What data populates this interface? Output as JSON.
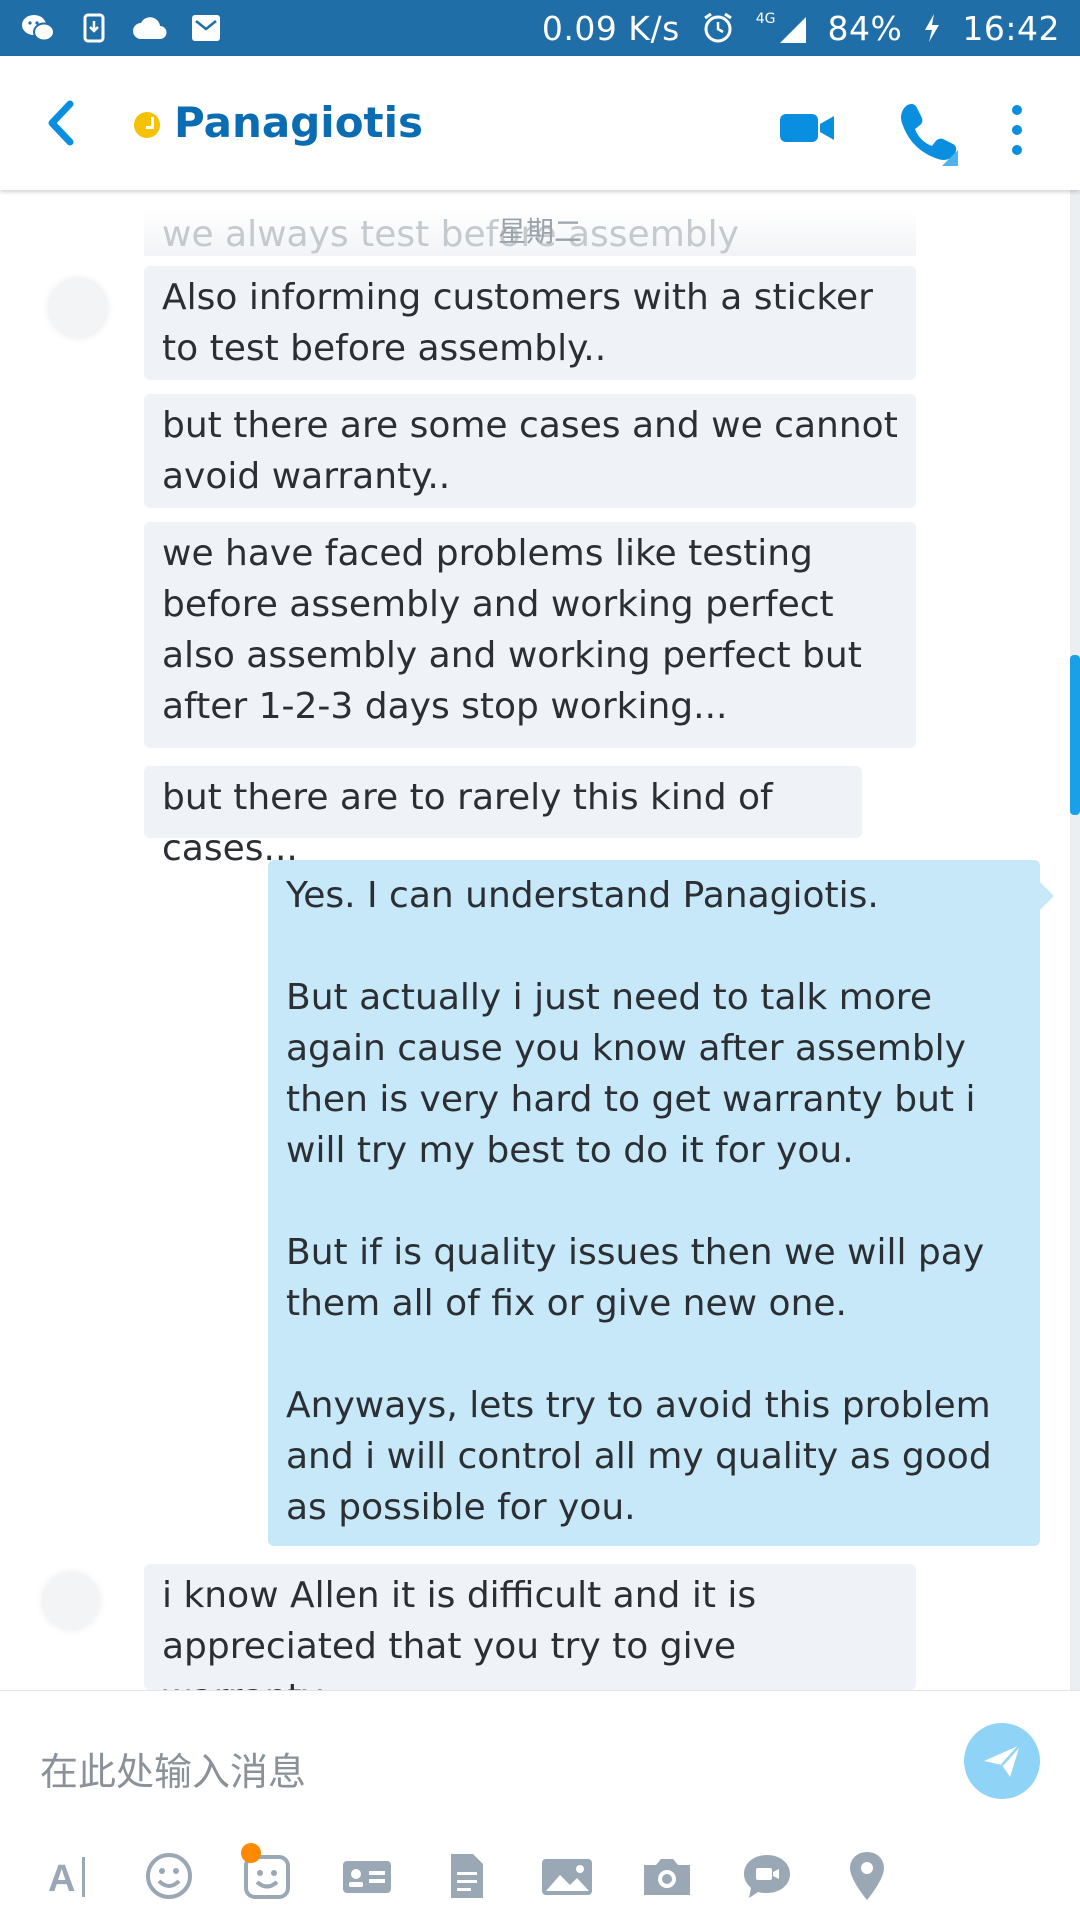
{
  "status_bar": {
    "speed": "0.09 K/s",
    "network": "4G",
    "battery": "84%",
    "time": "16:42"
  },
  "header": {
    "contact_name": "Panagiotis"
  },
  "chat": {
    "date_separator": "星期二",
    "faded_message": "we always test before assembly",
    "messages": [
      {
        "direction": "in",
        "text": "Also informing customers with a sticker to test before assembly.."
      },
      {
        "direction": "in",
        "text": "but there are some cases and we cannot avoid warranty.."
      },
      {
        "direction": "in",
        "text": "we have faced problems like testing before assembly and working perfect also assembly and working perfect but after 1-2-3 days stop working..."
      },
      {
        "direction": "in",
        "text": "but there are to rarely this kind of cases..."
      },
      {
        "direction": "out",
        "text": "Yes. I can understand Panagiotis.\n\nBut actually i just need to talk more again cause you know after assembly then is very hard to get warranty but i will try my best to do it for you.\n\nBut if is quality issues then we will pay them all of fix or give new one.\n\nAnyways, lets try to avoid this problem and i will control all my quality as good as possible for you."
      },
      {
        "direction": "in",
        "text": "i know Allen it is difficult and it is appreciated that you try to give warranty.."
      }
    ]
  },
  "composer": {
    "placeholder": "在此处输入消息",
    "value": ""
  },
  "colors": {
    "status_bar": "#1f6ea8",
    "brand": "#0a6db3",
    "incoming_bubble": "#eff2f6",
    "outgoing_bubble": "#c6e8f9",
    "send_button": "#8fd3f7",
    "presence_away": "#f4c200"
  },
  "icons": {
    "status_left": [
      "wechat-icon",
      "download-icon",
      "cloud-icon",
      "mail-icon"
    ],
    "status_right": [
      "alarm-icon",
      "signal-icon",
      "charging-icon"
    ],
    "header": [
      "back-icon",
      "video-call-icon",
      "phone-icon",
      "more-icon"
    ],
    "toolbar": [
      "text-format-icon",
      "emoji-icon",
      "sticker-icon",
      "contact-card-icon",
      "file-icon",
      "photo-icon",
      "camera-icon",
      "video-message-icon",
      "location-icon"
    ]
  }
}
